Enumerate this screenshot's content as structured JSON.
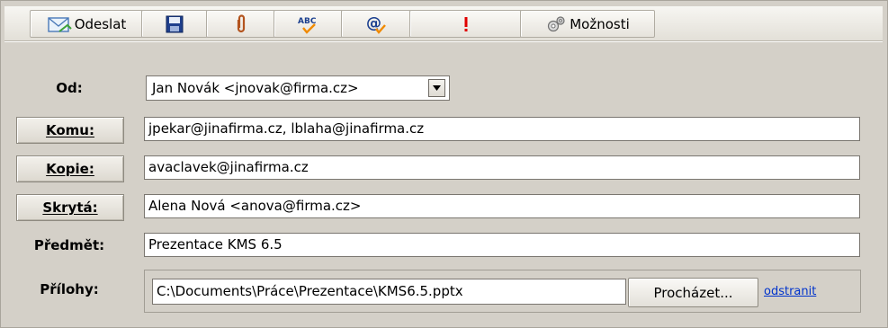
{
  "toolbar": {
    "send_label": "Odeslat",
    "options_label": "Možnosti",
    "icons": [
      "envelope-icon",
      "save-icon",
      "paperclip-icon",
      "spellcheck-icon",
      "address-book-icon",
      "priority-icon",
      "gear-icon"
    ]
  },
  "form": {
    "from": {
      "label": "Od:",
      "value": "Jan Novák <jnovak@firma.cz>"
    },
    "to": {
      "label": "Komu:",
      "value": "jpekar@jinafirma.cz, lblaha@jinafirma.cz"
    },
    "cc": {
      "label": "Kopie:",
      "value": "avaclavek@jinafirma.cz"
    },
    "bcc": {
      "label": "Skrytá:",
      "value": "Alena Nová <anova@firma.cz>"
    },
    "subject": {
      "label": "Předmět:",
      "value": "Prezentace KMS 6.5"
    },
    "attachments": {
      "label": "Přílohy:",
      "value": "C:\\Documents\\Práce\\Prezentace\\KMS6.5.pptx",
      "browse_label": "Procházet...",
      "remove_label": "odstranit"
    }
  },
  "colors": {
    "background": "#d4d0c8",
    "link": "#0033cc",
    "priority": "#e00000",
    "spellcheck_accent": "#f08a00"
  }
}
